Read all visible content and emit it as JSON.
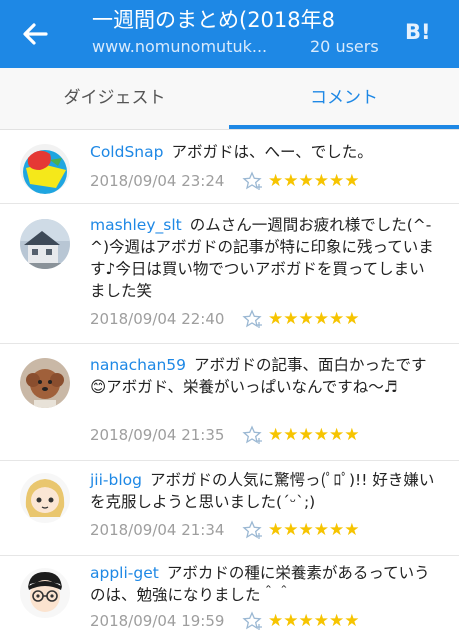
{
  "header": {
    "title": "一週間のまとめ(2018年8",
    "url": "www.nomunomutuk...",
    "users": "20 users",
    "bookmark_logo": "B!"
  },
  "tabs": [
    {
      "label": "ダイジェスト",
      "active": false
    },
    {
      "label": "コメント",
      "active": true
    }
  ],
  "comments": [
    {
      "user": "ColdSnap",
      "text": "アボガドは、へー、でした。",
      "date": "2018/09/04 23:24",
      "stars": "★★★★★★"
    },
    {
      "user": "mashley_slt",
      "text": "のムさん一週間お疲れ様でした(^-^)今週はアボガドの記事が特に印象に残っています♪今日は買い物でついアボガドを買ってしまいました笑",
      "date": "2018/09/04 22:40",
      "stars": "★★★★★★"
    },
    {
      "user": "nanachan59",
      "text": "アボガドの記事、面白かったです😊アボガド、栄養がいっぱいなんですね〜♬",
      "date": "2018/09/04 21:35",
      "stars": "★★★★★★"
    },
    {
      "user": "jii-blog",
      "text": "アボガドの人気に驚愕っ(ﾟﾛﾟ)!! 好き嫌いを克服しようと思いました(´ᵕ`;)",
      "date": "2018/09/04 21:34",
      "stars": "★★★★★★"
    },
    {
      "user": "appli-get",
      "text": "アボカドの種に栄養素があるっていうのは、勉強になりました＾＾",
      "date": "2018/09/04 19:59",
      "stars": "★★★★★★"
    }
  ],
  "colors": {
    "accent": "#1e88e5",
    "star": "#f6c400"
  }
}
